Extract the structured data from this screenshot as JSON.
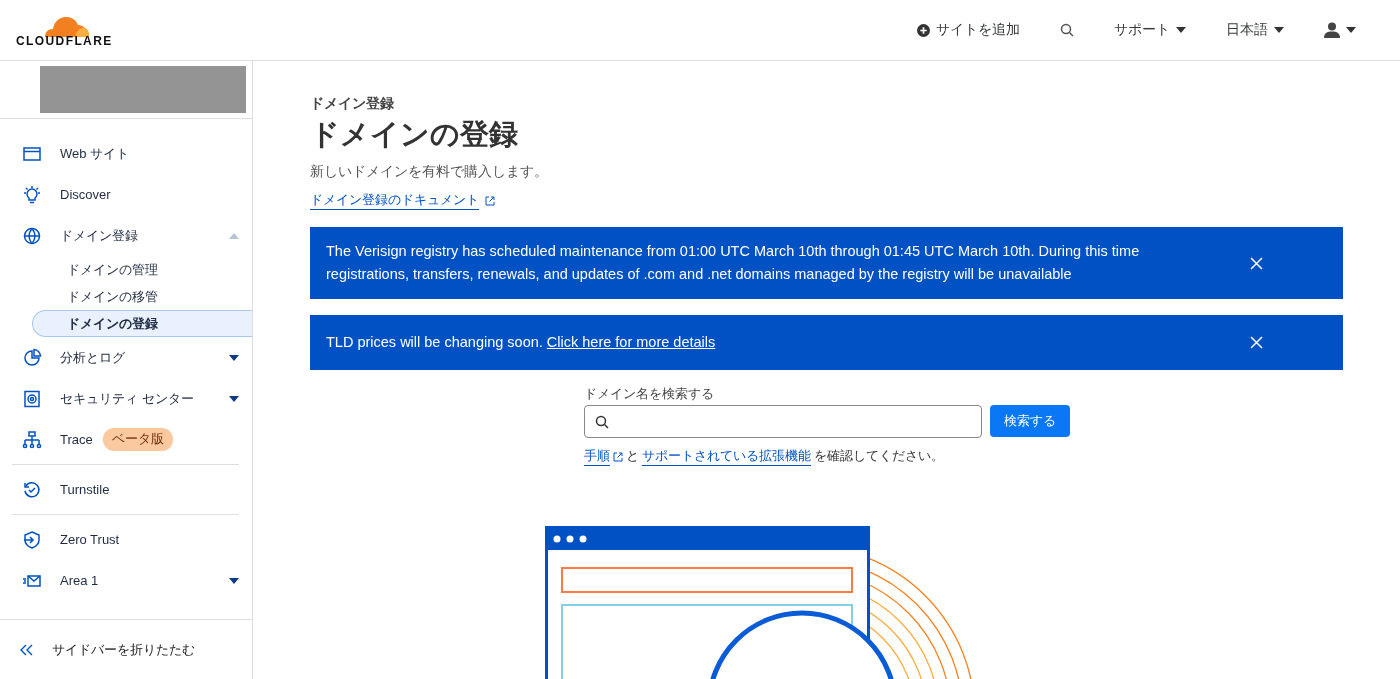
{
  "header": {
    "logo": "CLOUDFLARE",
    "nav": [
      {
        "kind": "add",
        "label": "サイトを追加"
      },
      {
        "kind": "search"
      },
      {
        "kind": "menu",
        "label": "サポート"
      },
      {
        "kind": "menu",
        "label": "日本語"
      },
      {
        "kind": "user"
      }
    ]
  },
  "sidebar": {
    "groups": [
      {
        "items": [
          {
            "label": "Web サイト"
          },
          {
            "label": "Discover"
          },
          {
            "label": "ドメイン登録",
            "expanded": true,
            "children": [
              {
                "label": "ドメインの管理",
                "selected": false
              },
              {
                "label": "ドメインの移管",
                "selected": false
              },
              {
                "label": "ドメインの登録",
                "selected": true
              }
            ]
          },
          {
            "label": "分析とログ",
            "expanded": false
          },
          {
            "label": "セキュリティ センター",
            "expanded": false
          },
          {
            "label": "Trace",
            "badge": "ベータ版"
          }
        ]
      },
      {
        "items": [
          {
            "label": "Turnstile"
          }
        ]
      },
      {
        "items": [
          {
            "label": "Zero Trust"
          },
          {
            "label": "Area 1",
            "expanded": false
          }
        ]
      }
    ],
    "collapse": "サイドバーを折りたたむ"
  },
  "main": {
    "breadcrumb": "ドメイン登録",
    "title": "ドメインの登録",
    "description": "新しいドメインを有料で購入します。",
    "doc_link": "ドメイン登録のドキュメント",
    "banners": [
      {
        "segments": [
          {
            "kind": "text",
            "text": "The Verisign registry has scheduled maintenance from 01:00 UTC March 10th through 01:45 UTC March 10th. During this time registrations, transfers, renewals, and updates of .com and .net domains managed by the registry will be unavailable"
          }
        ]
      },
      {
        "segments": [
          {
            "kind": "text",
            "text": "TLD prices will be changing soon. "
          },
          {
            "kind": "link",
            "text": "Click here for more details"
          }
        ]
      }
    ],
    "search": {
      "label": "ドメイン名を検索する",
      "button": "検索する"
    },
    "help": [
      {
        "kind": "external_link",
        "text": "手順"
      },
      {
        "kind": "text",
        "text": "と"
      },
      {
        "kind": "link",
        "text": "サポートされている拡張機能"
      },
      {
        "kind": "text",
        "text": "を確認してください。"
      }
    ]
  }
}
